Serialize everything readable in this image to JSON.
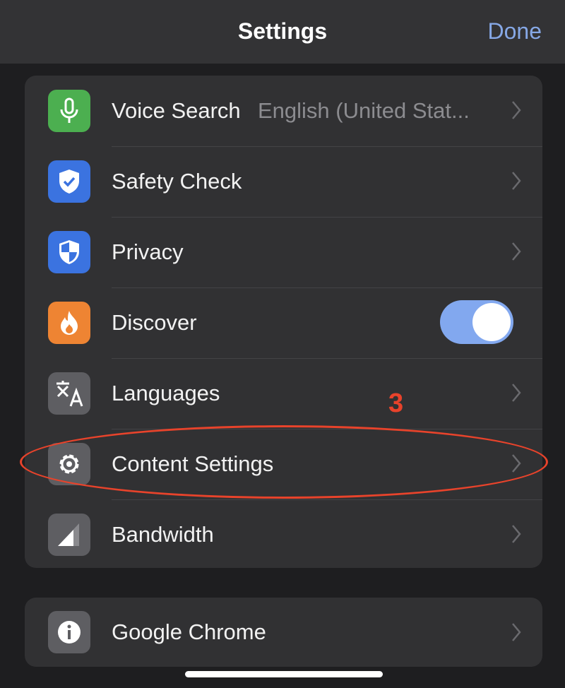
{
  "header": {
    "title": "Settings",
    "done_label": "Done"
  },
  "main_items": [
    {
      "label": "Voice Search",
      "value": "English (United Stat...",
      "icon": "microphone-icon",
      "icon_color": "#4caf50"
    },
    {
      "label": "Safety Check",
      "icon": "shield-check-icon",
      "icon_color": "#3b73e0"
    },
    {
      "label": "Privacy",
      "icon": "shield-icon",
      "icon_color": "#3b73e0"
    },
    {
      "label": "Discover",
      "icon": "flame-icon",
      "icon_color": "#ee8433",
      "toggle_on": true
    },
    {
      "label": "Languages",
      "icon": "translate-icon",
      "icon_color": "#5e5e62"
    },
    {
      "label": "Content Settings",
      "icon": "gear-icon",
      "icon_color": "#5e5e62"
    },
    {
      "label": "Bandwidth",
      "icon": "signal-icon",
      "icon_color": "#5e5e62"
    }
  ],
  "secondary_items": [
    {
      "label": "Google Chrome",
      "icon": "info-icon",
      "icon_color": "#5e5e62"
    }
  ],
  "annotation": {
    "step": "3",
    "color": "#e8432b"
  },
  "colors": {
    "accent": "#86a8e6",
    "toggle": "#82a8ef"
  }
}
